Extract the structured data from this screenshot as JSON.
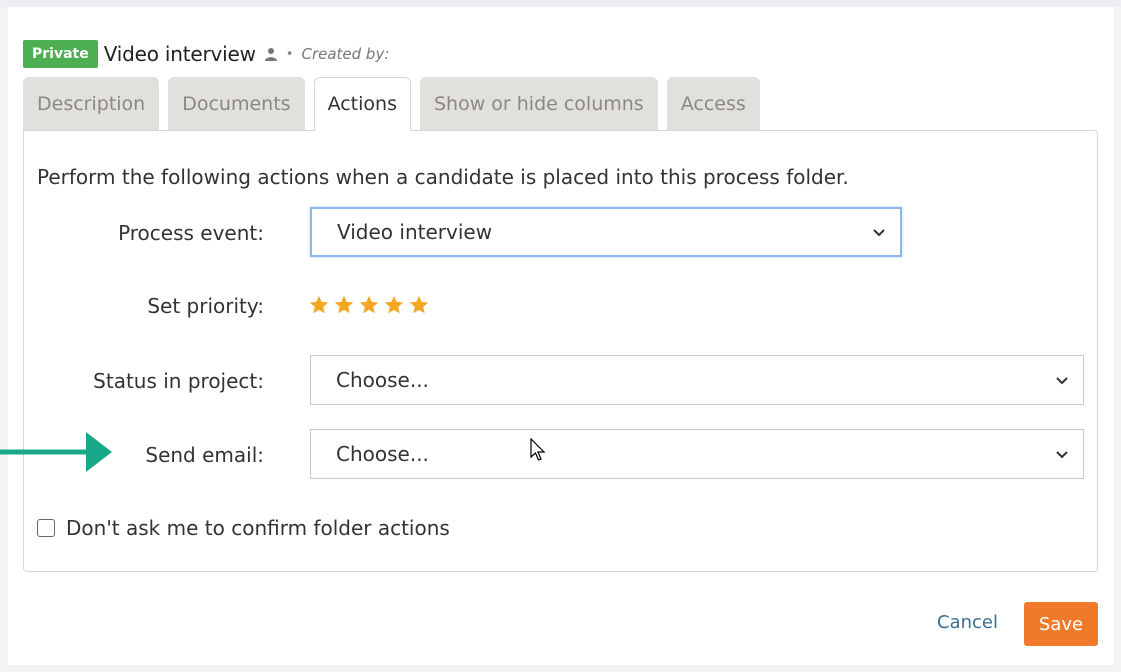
{
  "header": {
    "badge": "Private",
    "title": "Video interview",
    "separator": "•",
    "created_label": "Created by:"
  },
  "tabs": [
    {
      "label": "Description",
      "active": false
    },
    {
      "label": "Documents",
      "active": false
    },
    {
      "label": "Actions",
      "active": true
    },
    {
      "label": "Show or hide columns",
      "active": false
    },
    {
      "label": "Access",
      "active": false
    }
  ],
  "panel": {
    "intro": "Perform the following actions when a candidate is placed into this process folder.",
    "process_event": {
      "label": "Process event:",
      "value": "Video interview"
    },
    "priority": {
      "label": "Set priority:",
      "stars": 5,
      "max": 5
    },
    "status": {
      "label": "Status in project:",
      "value": "Choose..."
    },
    "send_email": {
      "label": "Send email:",
      "value": "Choose..."
    },
    "confirm": {
      "label": "Don't ask me to confirm folder actions",
      "checked": false
    }
  },
  "footer": {
    "cancel": "Cancel",
    "save": "Save"
  },
  "colors": {
    "badge": "#4caf50",
    "star": "#f5a623",
    "save": "#f07a2a",
    "arrow": "#1aa88a",
    "cancel": "#3b6e8f"
  }
}
